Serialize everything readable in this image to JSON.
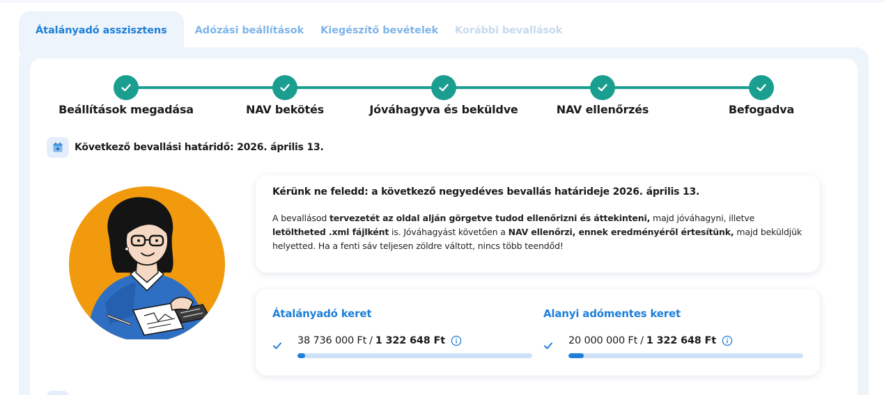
{
  "tabs": [
    {
      "label": "Átalányadó asszisztens",
      "state": "active"
    },
    {
      "label": "Adózási beállítások",
      "state": "normal"
    },
    {
      "label": "Kiegészítő bevételek",
      "state": "normal"
    },
    {
      "label": "Korábbi bevallások",
      "state": "disabled"
    }
  ],
  "stepper": {
    "color": "#1a9e8f",
    "steps": [
      {
        "label": "Beállítások megadása",
        "done": true
      },
      {
        "label": "NAV bekötés",
        "done": true
      },
      {
        "label": "Jóváhagyva és beküldve",
        "done": true
      },
      {
        "label": "NAV ellenőrzés",
        "done": true
      },
      {
        "label": "Befogadva",
        "done": true
      }
    ]
  },
  "deadline": {
    "icon": "calendar-star-icon",
    "text": "Következő bevallási határidő: 2026. április 13."
  },
  "info": {
    "title": "Kérünk ne feledd: a következő negyedéves bevallás határideje 2026. április 13.",
    "p1": "A bevallásod ",
    "b1": "tervezetét az oldal alján görgetve tudod ellenőrizni és áttekinteni,",
    "p2": " majd jóváhagyni, illetve ",
    "b2": "letöltheted .xml fájlként",
    "p3": " is. Jóváhagyást követően a ",
    "b3": "NAV ellenőrzi, ennek eredményéről értesítünk,",
    "p4": " majd beküldjük helyetted. Ha a fenti sáv teljesen zöldre váltott, nincs több teendőd!"
  },
  "limits": [
    {
      "title": "Átalányadó keret",
      "limit": "38 736 000 Ft",
      "separator": "/",
      "used": "1 322 648 Ft",
      "fill_fraction": 0.034
    },
    {
      "title": "Alanyi adómentes keret",
      "limit": "20 000 000 Ft",
      "separator": "/",
      "used": "1 322 648 Ft",
      "fill_fraction": 0.066
    }
  ],
  "colors": {
    "accent": "#1e7fd8",
    "success": "#1a9e8f",
    "illustration_bg": "#f19a0e"
  }
}
